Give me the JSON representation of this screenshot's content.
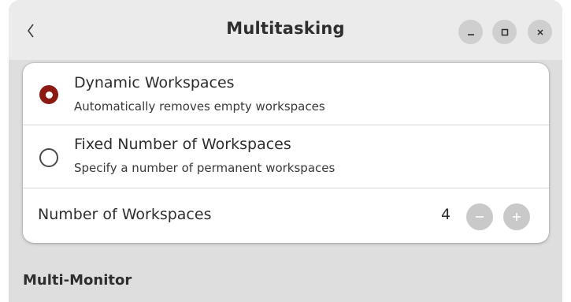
{
  "window": {
    "title": "Multitasking",
    "icons": {
      "back": "chevron-left-icon",
      "minimize": "minimize-icon",
      "maximize": "maximize-icon",
      "close": "close-icon"
    }
  },
  "workspaces": {
    "options": [
      {
        "title": "Dynamic Workspaces",
        "subtitle": "Automatically removes empty workspaces",
        "selected": true
      },
      {
        "title": "Fixed Number of Workspaces",
        "subtitle": "Specify a number of permanent workspaces",
        "selected": false
      }
    ],
    "count": {
      "label": "Number of Workspaces",
      "value": "4",
      "decrement_icon": "minus-icon",
      "increment_icon": "plus-icon"
    }
  },
  "sections": {
    "multi_monitor": "Multi-Monitor"
  },
  "colors": {
    "accent": "#8b1a12",
    "header": "#ebebeb",
    "window_bg": "#dedede",
    "card_bg": "#ffffff"
  }
}
